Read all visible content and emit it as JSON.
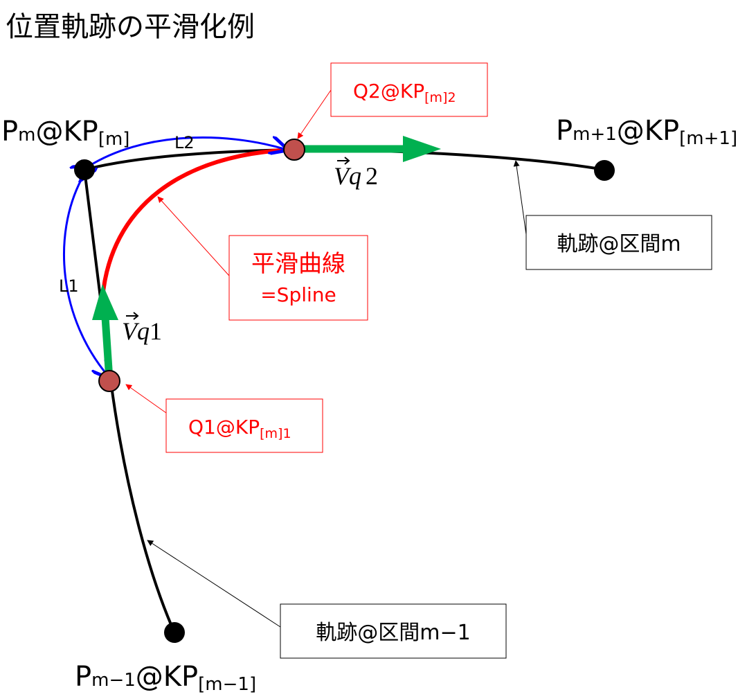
{
  "title": "位置軌跡の平滑化例",
  "colors": {
    "trajectory": "#000000",
    "spline": "#ff0000",
    "vector": "#00b050",
    "length": "#0000ff",
    "q_point": "#c0504d",
    "red_label": "#ff0000"
  },
  "points": {
    "pm": {
      "base": "P",
      "sub": "m",
      "at": "@KP",
      "bracket": "[m]"
    },
    "pm1": {
      "base": "P",
      "sub": "m+1",
      "at": "@KP",
      "bracket": "[m+1]"
    },
    "pmm1": {
      "base": "P",
      "sub": "m−1",
      "at": "@KP",
      "bracket": "[m−1]"
    }
  },
  "labels": {
    "q2": {
      "main": "Q2@KP",
      "sub": "[m]2"
    },
    "q1": {
      "main": "Q1@KP",
      "sub": "[m]1"
    },
    "spline": {
      "line1": "平滑曲線",
      "line2": "=Spline"
    },
    "segment_m": "軌跡@区間m",
    "segment_m_minus_1": "軌跡@区間m−1",
    "l1": "L1",
    "l2": "L2",
    "vq1": {
      "base": "V",
      "var": "q",
      "num": "1"
    },
    "vq2": {
      "base": "V",
      "var": "q",
      "num": "2"
    }
  }
}
